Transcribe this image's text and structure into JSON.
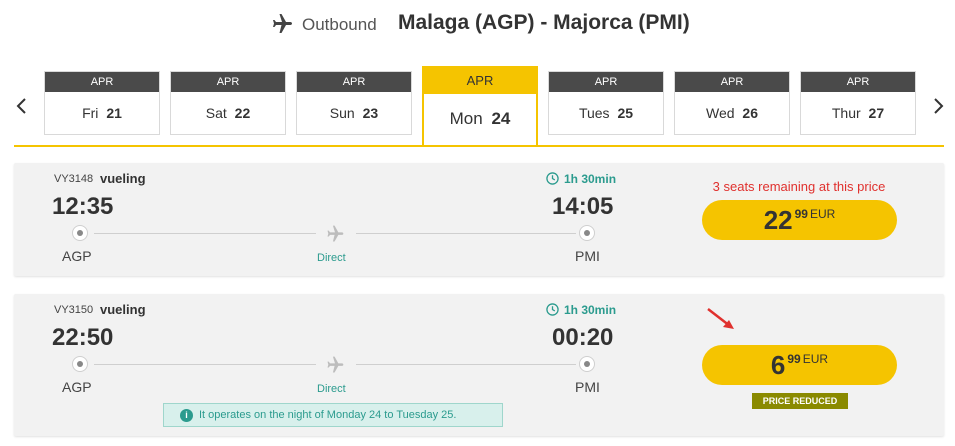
{
  "header": {
    "label": "Outbound",
    "route": "Malaga (AGP) - Majorca (PMI)"
  },
  "dates": [
    {
      "month": "APR",
      "weekday": "Fri",
      "day": "21"
    },
    {
      "month": "APR",
      "weekday": "Sat",
      "day": "22"
    },
    {
      "month": "APR",
      "weekday": "Sun",
      "day": "23"
    },
    {
      "month": "APR",
      "weekday": "Mon",
      "day": "24"
    },
    {
      "month": "APR",
      "weekday": "Tues",
      "day": "25"
    },
    {
      "month": "APR",
      "weekday": "Wed",
      "day": "26"
    },
    {
      "month": "APR",
      "weekday": "Thur",
      "day": "27"
    }
  ],
  "selected_date_index": 3,
  "flights": [
    {
      "flight_number": "VY3148",
      "airline": "vueling",
      "duration": "1h 30min",
      "dep_time": "12:35",
      "arr_time": "14:05",
      "dep_code": "AGP",
      "arr_code": "PMI",
      "stops": "Direct",
      "seats_note": "3 seats remaining at this price",
      "price_int": "22",
      "price_dec": "99",
      "currency": "EUR"
    },
    {
      "flight_number": "VY3150",
      "airline": "vueling",
      "duration": "1h 30min",
      "dep_time": "22:50",
      "arr_time": "00:20",
      "dep_code": "AGP",
      "arr_code": "PMI",
      "stops": "Direct",
      "info_note": "It operates on the night of Monday 24 to Tuesday 25.",
      "price_int": "6",
      "price_dec": "99",
      "currency": "EUR",
      "badge": "PRICE REDUCED"
    }
  ],
  "colors": {
    "accent": "#f5c400",
    "teal": "#2b9b8e",
    "alert": "#e0312e",
    "badge": "#8a8a00"
  }
}
